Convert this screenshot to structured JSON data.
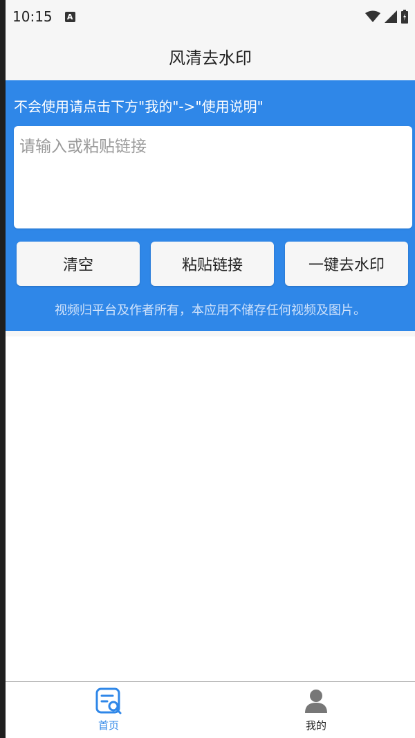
{
  "status_bar": {
    "time": "10:15",
    "notif_letter": "A"
  },
  "app_bar": {
    "title": "风清去水印"
  },
  "panel": {
    "instruction": "不会使用请点击下方\"我的\"->\"使用说明\"",
    "input": {
      "value": "",
      "placeholder": "请输入或粘贴链接"
    },
    "buttons": {
      "clear": "清空",
      "paste": "粘贴链接",
      "remove": "一键去水印"
    },
    "disclaimer": "视频归平台及作者所有，本应用不储存任何视频及图片。"
  },
  "bottom_nav": {
    "items": [
      {
        "label": "首页",
        "icon": "search-document-icon",
        "active": true
      },
      {
        "label": "我的",
        "icon": "person-icon",
        "active": false
      }
    ]
  },
  "colors": {
    "accent": "#2f87e8",
    "nav_inactive": "#777777"
  }
}
